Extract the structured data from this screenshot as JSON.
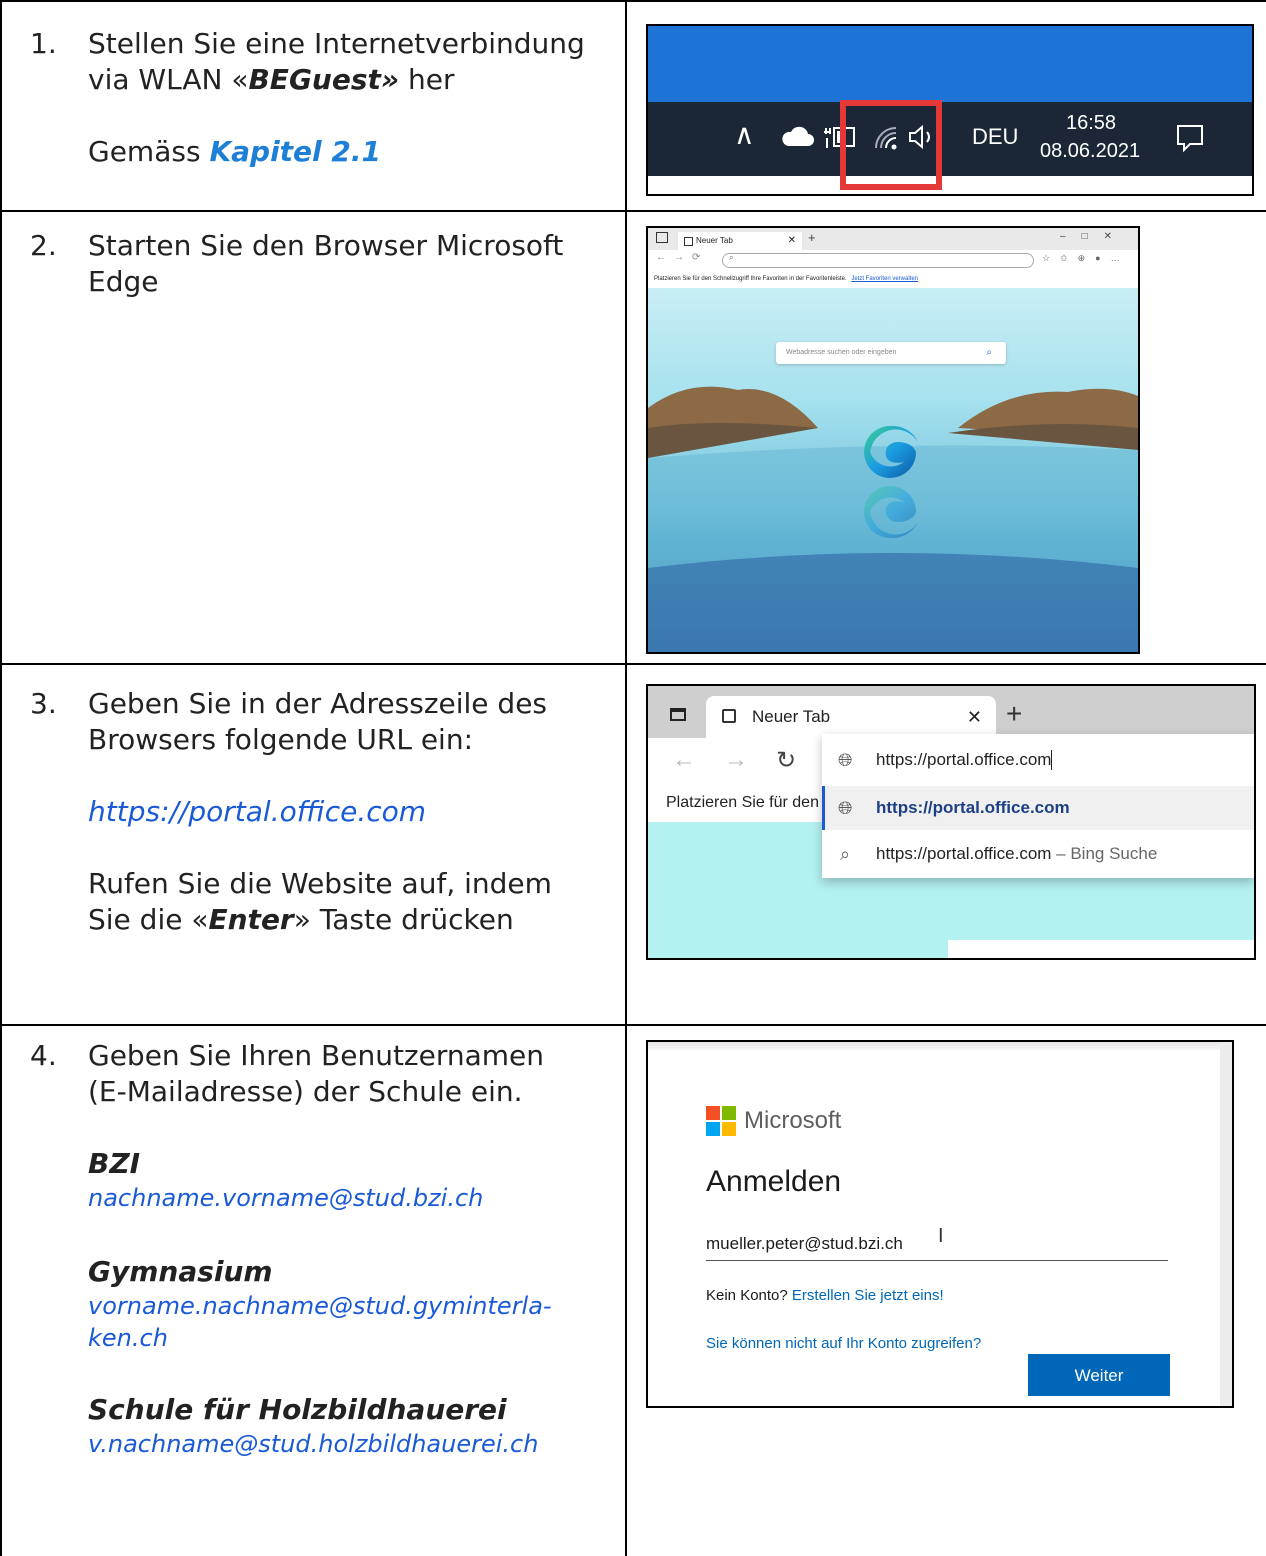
{
  "steps": [
    {
      "number": "1.",
      "line1": "Stellen Sie eine Internetverbindung",
      "line2_pre": "via WLAN «",
      "line2_em": "BEGuest»",
      "line2_post": " her",
      "ref_pre": "Gemäss ",
      "ref_link": "Kapitel 2.1"
    },
    {
      "number": "2.",
      "line1": "Starten Sie den Browser Microsoft",
      "line2": "Edge"
    },
    {
      "number": "3.",
      "line1": "Geben Sie in der Adresszeile des",
      "line2": "Browsers folgende URL ein:",
      "url": "https://portal.office.com",
      "line3": "Rufen Sie die Website auf, indem",
      "line4_pre": "Sie die «",
      "line4_em": "Enter",
      "line4_post": "» Taste drücken"
    },
    {
      "number": "4.",
      "line1": "Geben Sie Ihren Benutzernamen",
      "line2": "(E-Mailadresse) der Schule ein.",
      "schools": [
        {
          "name": "BZI",
          "mail1": "nachname.vorname@stud.bzi.ch",
          "mail2": ""
        },
        {
          "name": "Gymnasium",
          "mail1": "vorname.nachname@stud.gyminterla-",
          "mail2": "ken.ch"
        },
        {
          "name": "Schule für Holzbildhauerei",
          "mail1": "v.nachname@stud.holzbildhauerei.ch",
          "mail2": ""
        }
      ]
    }
  ],
  "taskbar": {
    "language": "DEU",
    "time": "16:58",
    "date": "08.06.2021",
    "icons": [
      "chevron-up-icon",
      "cloud-icon",
      "battery-icon",
      "wifi-icon",
      "speaker-icon",
      "notification-icon"
    ],
    "highlight_color": "#e53939"
  },
  "edge_newtab": {
    "tab_label": "Neuer Tab",
    "favorites_text": "Platzieren Sie für den Schnellzugriff Ihre Favoriten in der Favoritenleiste.",
    "favorites_link": "Jetzt Favoriten verwalten",
    "search_placeholder": "Webadresse suchen oder eingeben"
  },
  "edge_address": {
    "tab_label": "Neuer Tab",
    "typed_url": "https://portal.office.com",
    "suggestion_bold": "https://portal.office.com",
    "search_suggestion": "https://portal.office.com",
    "search_suffix": " – Bing Suche",
    "favorites_partial": "Platzieren Sie für den Sc"
  },
  "signin": {
    "brand": "Microsoft",
    "title": "Anmelden",
    "input_value": "mueller.peter@stud.bzi.ch",
    "no_account": "Kein Konto?",
    "create_link": "Erstellen Sie jetzt eins!",
    "cant_access": "Sie können nicht auf Ihr Konto zugreifen?",
    "next_button": "Weiter",
    "accent": "#0067b8"
  }
}
